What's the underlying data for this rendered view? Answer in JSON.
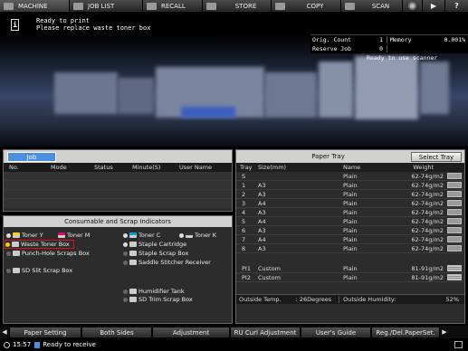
{
  "topbar": {
    "tabs": [
      {
        "label": "MACHINE",
        "icon": "printer-icon"
      },
      {
        "label": "JOB LIST",
        "icon": "list-icon"
      },
      {
        "label": "RECALL",
        "icon": "recall-icon"
      },
      {
        "label": "STORE",
        "icon": "store-icon"
      },
      {
        "label": "COPY",
        "icon": "copy-icon"
      },
      {
        "label": "SCAN",
        "icon": "scan-icon"
      }
    ]
  },
  "message": {
    "line1": "Ready to print",
    "line2": "Please replace waste toner box"
  },
  "counters": {
    "orig_count_label": "Orig. Count",
    "orig_count_value": "1",
    "memory_label": "Memory",
    "memory_value": "0.001%",
    "reserve_job_label": "Reserve Job",
    "reserve_job_value": "0",
    "scanner_status": "Ready to use scanner"
  },
  "job_panel": {
    "tab_label": "Job",
    "columns": [
      "No.",
      "Mode",
      "Status",
      "Minute(S)",
      "User Name"
    ]
  },
  "consumables": {
    "title": "Consumable and Scrap Indicators",
    "items": [
      {
        "label": "Toner Y",
        "state": "ok"
      },
      {
        "label": "Toner M",
        "state": "ok"
      },
      {
        "label": "Toner C",
        "state": "ok"
      },
      {
        "label": "Toner K",
        "state": "ok"
      },
      {
        "label": "Waste Toner Box",
        "state": "warning"
      },
      {
        "label": "Punch-Hole Scraps Box",
        "state": "ok"
      },
      {
        "label": "Staple Cartridge",
        "state": "ok"
      },
      {
        "label": "Staple Scrap Box",
        "state": "ok"
      },
      {
        "label": "Saddle Stitcher Receiver",
        "state": "ok"
      },
      {
        "label": "SD Slit Scrap Box",
        "state": "ok"
      },
      {
        "label": "Humidifier Tank",
        "state": "ok"
      },
      {
        "label": "SD Trim Scrap Box",
        "state": "ok"
      }
    ],
    "highlight_color": "#e0101a"
  },
  "paper_tray": {
    "title": "Paper Tray",
    "select_button": "Select Tray",
    "columns": [
      "Tray",
      "Size(mm)",
      "Name",
      "Weight"
    ],
    "rows": [
      {
        "tray": "S",
        "size": "",
        "name": "Plain",
        "weight": "62-74g/m2"
      },
      {
        "tray": "1",
        "size": "A3",
        "name": "Plain",
        "weight": "62-74g/m2"
      },
      {
        "tray": "2",
        "size": "A3",
        "name": "Plain",
        "weight": "62-74g/m2"
      },
      {
        "tray": "3",
        "size": "A4",
        "name": "Plain",
        "weight": "62-74g/m2"
      },
      {
        "tray": "4",
        "size": "A3",
        "name": "Plain",
        "weight": "62-74g/m2"
      },
      {
        "tray": "5",
        "size": "A4",
        "name": "Plain",
        "weight": "62-74g/m2"
      },
      {
        "tray": "6",
        "size": "A3",
        "name": "Plain",
        "weight": "62-74g/m2"
      },
      {
        "tray": "7",
        "size": "A4",
        "name": "Plain",
        "weight": "62-74g/m2"
      },
      {
        "tray": "8",
        "size": "A3",
        "name": "Plain",
        "weight": "62-74g/m2"
      }
    ],
    "pi_rows": [
      {
        "tray": "PI1",
        "size": "Custom",
        "name": "Plain",
        "weight": "81-91g/m2"
      },
      {
        "tray": "PI2",
        "size": "Custom",
        "name": "Plain",
        "weight": "81-91g/m2"
      }
    ],
    "outside_temp_label": "Outside Temp.",
    "outside_temp_value": ": 26Degrees",
    "outside_humidity_label": "Outside Humidity:",
    "outside_humidity_value": "52%"
  },
  "bottom_buttons": [
    "Paper Setting",
    "Both Sides",
    "Adjustment",
    "RU Curl Adjustment",
    "User's Guide",
    "Reg./Del.PaperSet."
  ],
  "status_bar": {
    "time": "15:57",
    "text": "Ready to receive"
  }
}
